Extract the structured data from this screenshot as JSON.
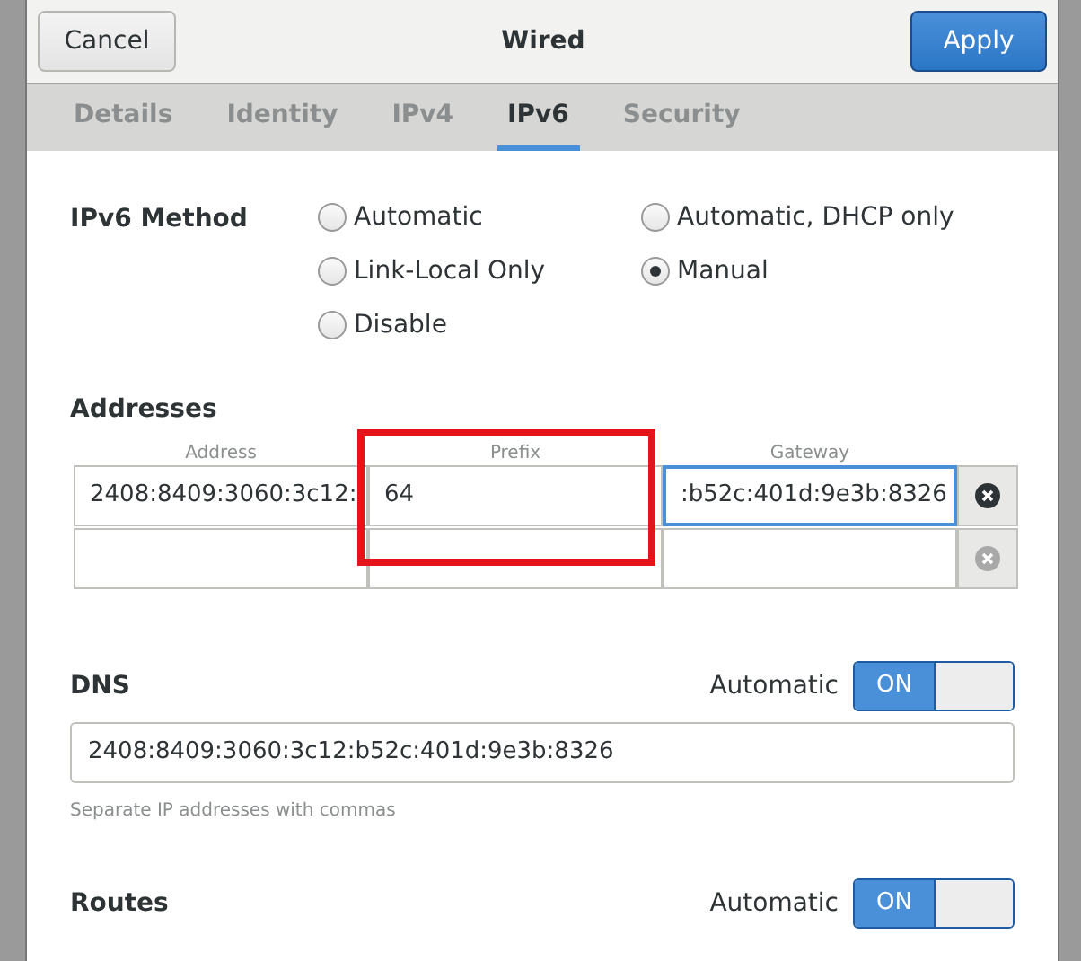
{
  "header": {
    "cancel": "Cancel",
    "title": "Wired",
    "apply": "Apply"
  },
  "tabs": [
    {
      "label": "Details",
      "selected": false
    },
    {
      "label": "Identity",
      "selected": false
    },
    {
      "label": "IPv4",
      "selected": false
    },
    {
      "label": "IPv6",
      "selected": true
    },
    {
      "label": "Security",
      "selected": false
    }
  ],
  "method": {
    "label": "IPv6 Method",
    "options": [
      {
        "label": "Automatic",
        "selected": false
      },
      {
        "label": "Automatic, DHCP only",
        "selected": false
      },
      {
        "label": "Link-Local Only",
        "selected": false
      },
      {
        "label": "Manual",
        "selected": true
      },
      {
        "label": "Disable",
        "selected": false
      }
    ]
  },
  "addresses": {
    "title": "Addresses",
    "columns": [
      "Address",
      "Prefix",
      "Gateway"
    ],
    "rows": [
      {
        "cells": [
          {
            "value": "2408:8409:3060:3c12:",
            "focused": false
          },
          {
            "value": "64",
            "focused": false
          },
          {
            "value": ":b52c:401d:9e3b:8326",
            "focused": true
          }
        ]
      },
      {
        "cells": [
          {
            "focused": false
          },
          {
            "focused": false
          },
          {
            "focused": false
          }
        ]
      }
    ]
  },
  "dns": {
    "title": "DNS",
    "automatic_label": "Automatic",
    "automatic": {
      "on": true,
      "label": "ON"
    },
    "value": "2408:8409:3060:3c12:b52c:401d:9e3b:8326",
    "hint": "Separate IP addresses with commas"
  },
  "routes": {
    "title": "Routes",
    "automatic_label": "Automatic",
    "automatic": {
      "on": true,
      "label": "ON"
    }
  }
}
